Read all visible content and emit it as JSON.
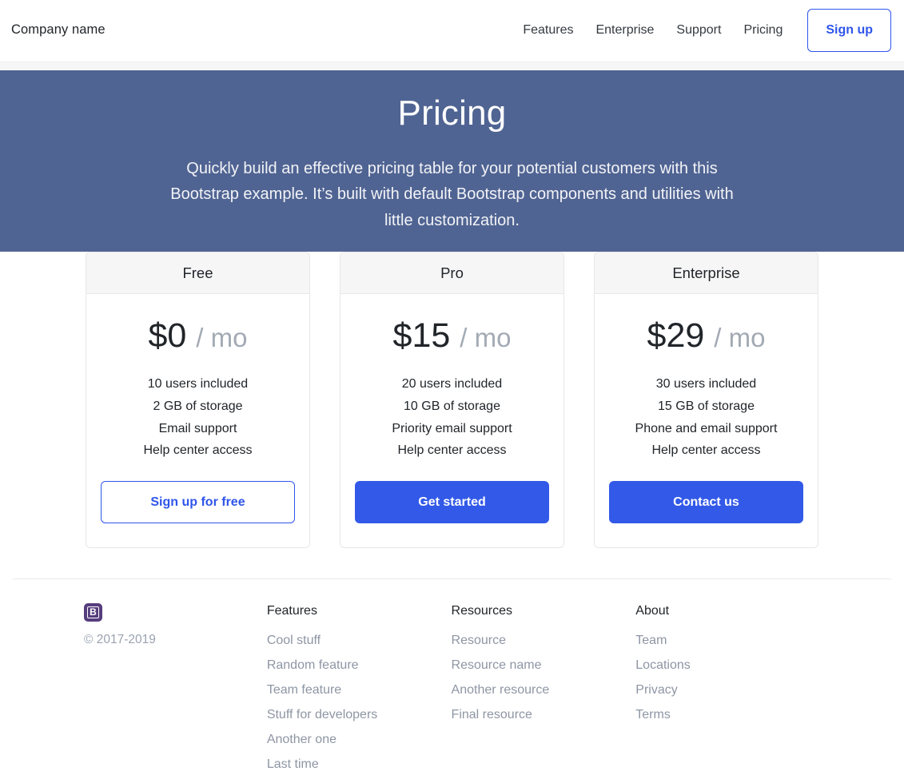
{
  "header": {
    "brand": "Company name",
    "nav": [
      {
        "label": "Features"
      },
      {
        "label": "Enterprise"
      },
      {
        "label": "Support"
      },
      {
        "label": "Pricing"
      }
    ],
    "signup_label": "Sign up"
  },
  "hero": {
    "title": "Pricing",
    "subtitle": "Quickly build an effective pricing table for your potential customers with this Bootstrap example. It’s built with default Bootstrap components and utilities with little customization.",
    "bg_color": "#506493"
  },
  "pricing": {
    "plans": [
      {
        "name": "Free",
        "price": "$0",
        "period": "/ mo",
        "features": [
          "10 users included",
          "2 GB of storage",
          "Email support",
          "Help center access"
        ],
        "cta": "Sign up for free",
        "cta_style": "outline"
      },
      {
        "name": "Pro",
        "price": "$15",
        "period": "/ mo",
        "features": [
          "20 users included",
          "10 GB of storage",
          "Priority email support",
          "Help center access"
        ],
        "cta": "Get started",
        "cta_style": "solid"
      },
      {
        "name": "Enterprise",
        "price": "$29",
        "period": "/ mo",
        "features": [
          "30 users included",
          "15 GB of storage",
          "Phone and email support",
          "Help center access"
        ],
        "cta": "Contact us",
        "cta_style": "solid"
      }
    ],
    "accent_color": "#3259e8",
    "muted_color": "#a3aab5"
  },
  "footer": {
    "logo_letter": "B",
    "logo_color": "#563d7c",
    "copyright": "© 2017-2019",
    "columns": [
      {
        "title": "Features",
        "links": [
          "Cool stuff",
          "Random feature",
          "Team feature",
          "Stuff for developers",
          "Another one",
          "Last time"
        ]
      },
      {
        "title": "Resources",
        "links": [
          "Resource",
          "Resource name",
          "Another resource",
          "Final resource"
        ]
      },
      {
        "title": "About",
        "links": [
          "Team",
          "Locations",
          "Privacy",
          "Terms"
        ]
      }
    ]
  }
}
